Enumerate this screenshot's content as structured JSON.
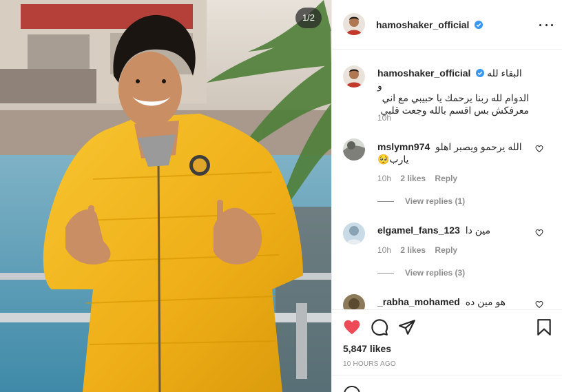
{
  "post": {
    "username": "hamoshaker_official",
    "verified": true,
    "image_counter": "1/2",
    "caption_line1": "البقاء لله و",
    "caption_rest": "الدوام لله ربنا يرحمك يا حبيبي مع اني معرفكش بس اقسم بالله وجعت قلبي",
    "caption_time": "10h",
    "likes": "5,847 likes",
    "posted_ago": "10 HOURS AGO"
  },
  "comments": [
    {
      "username": "mslymn974",
      "text": "الله يرحمو ويصبر اهلو يارب🥺",
      "time": "10h",
      "likes": "2 likes",
      "reply_label": "Reply",
      "view_replies": "View replies (1)"
    },
    {
      "username": "elgamel_fans_123",
      "text": "مين دا",
      "time": "10h",
      "likes": "2 likes",
      "reply_label": "Reply",
      "view_replies": "View replies (3)"
    },
    {
      "username": "_rabha_mohamed",
      "text": "هو مين ده"
    }
  ],
  "icons": {
    "more": "more-options-icon",
    "like": "heart-filled-icon",
    "comment": "comment-bubble-icon",
    "share": "paper-plane-icon",
    "save": "bookmark-icon",
    "verified": "verified-badge-icon"
  },
  "colors": {
    "like_red": "#ed4956",
    "verified_blue": "#3897f0",
    "text_primary": "#262626",
    "text_secondary": "#8e8e8e",
    "divider": "#efefef",
    "jacket_yellow": "#f2b51c"
  }
}
